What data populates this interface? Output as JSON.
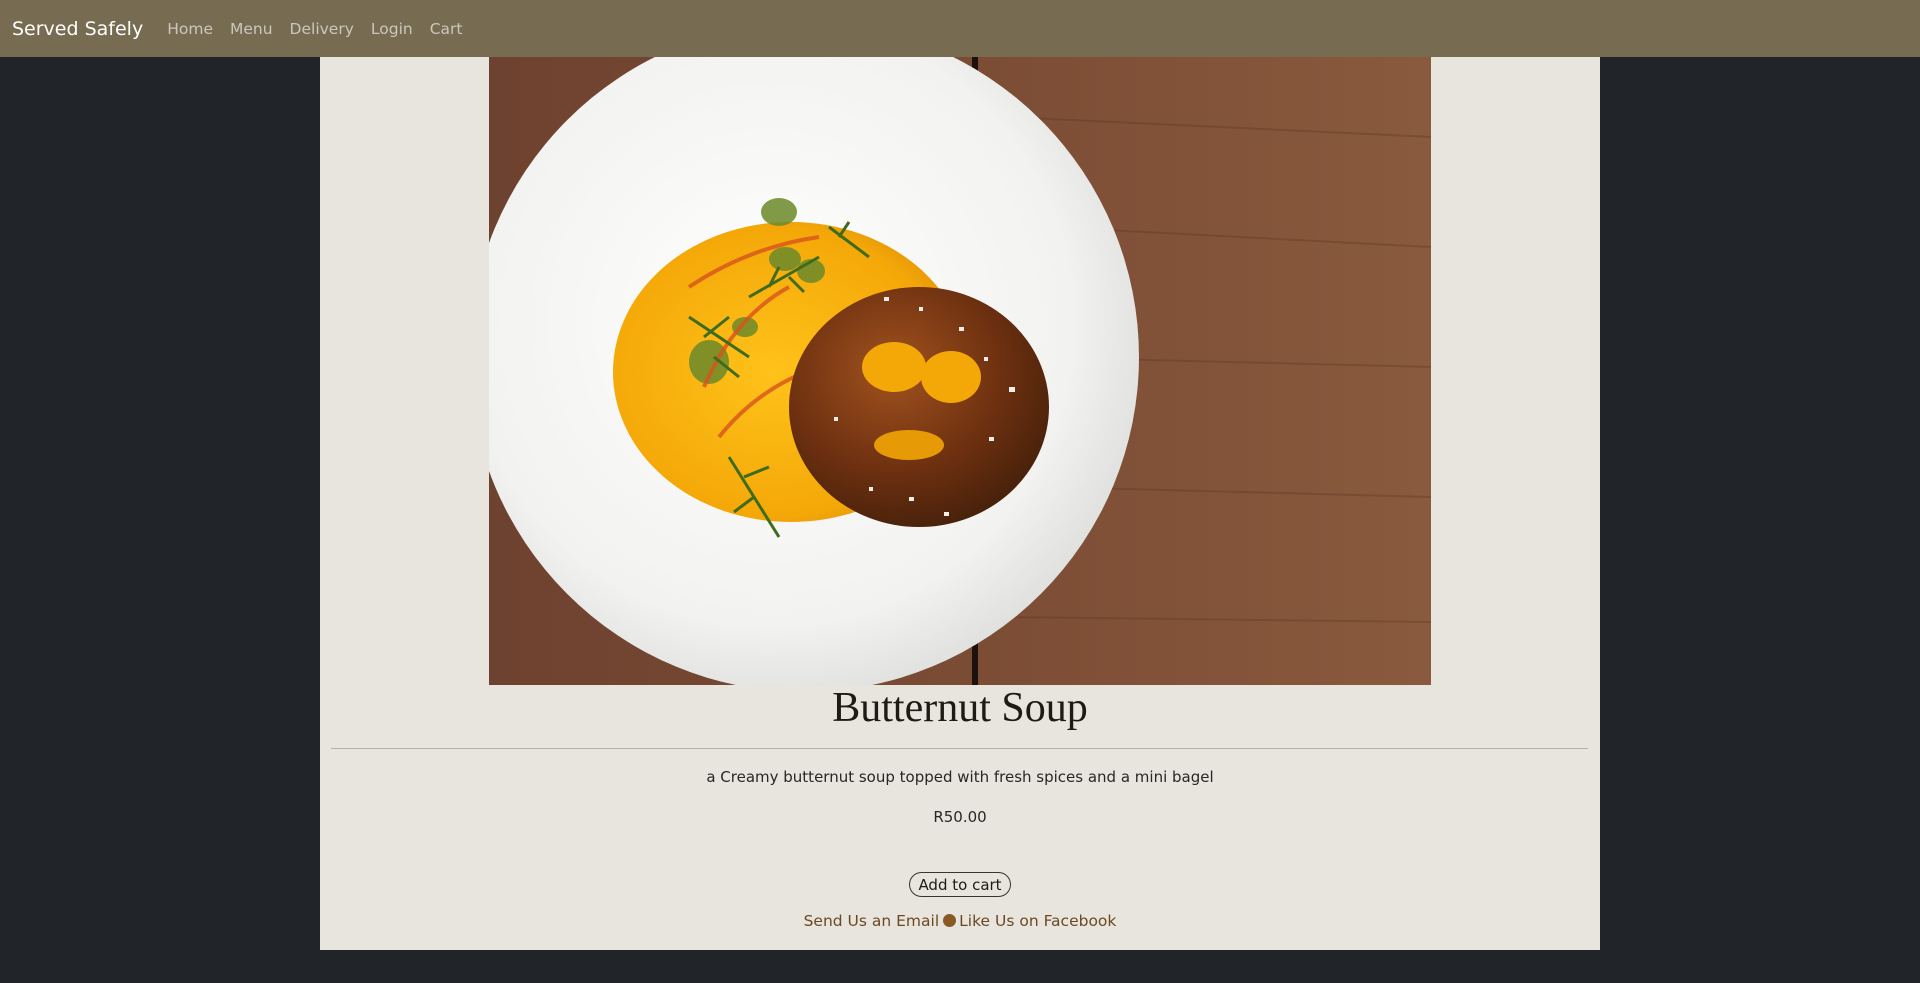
{
  "navbar": {
    "brand": "Served Safely",
    "links": [
      "Home",
      "Menu",
      "Delivery",
      "Login",
      "Cart"
    ]
  },
  "product": {
    "name": "Butternut Soup",
    "description": "a Creamy butternut soup topped with fresh spices and a mini bagel",
    "price": "R50.00",
    "add_to_cart_label": "Add to cart"
  },
  "footer": {
    "email_label": "Send Us an Email",
    "facebook_label": "Like Us on Facebook"
  },
  "colors": {
    "page_background": "#212529",
    "navbar": "#776b52",
    "panel": "#e8e4de",
    "footer_link": "#6b4a22"
  }
}
